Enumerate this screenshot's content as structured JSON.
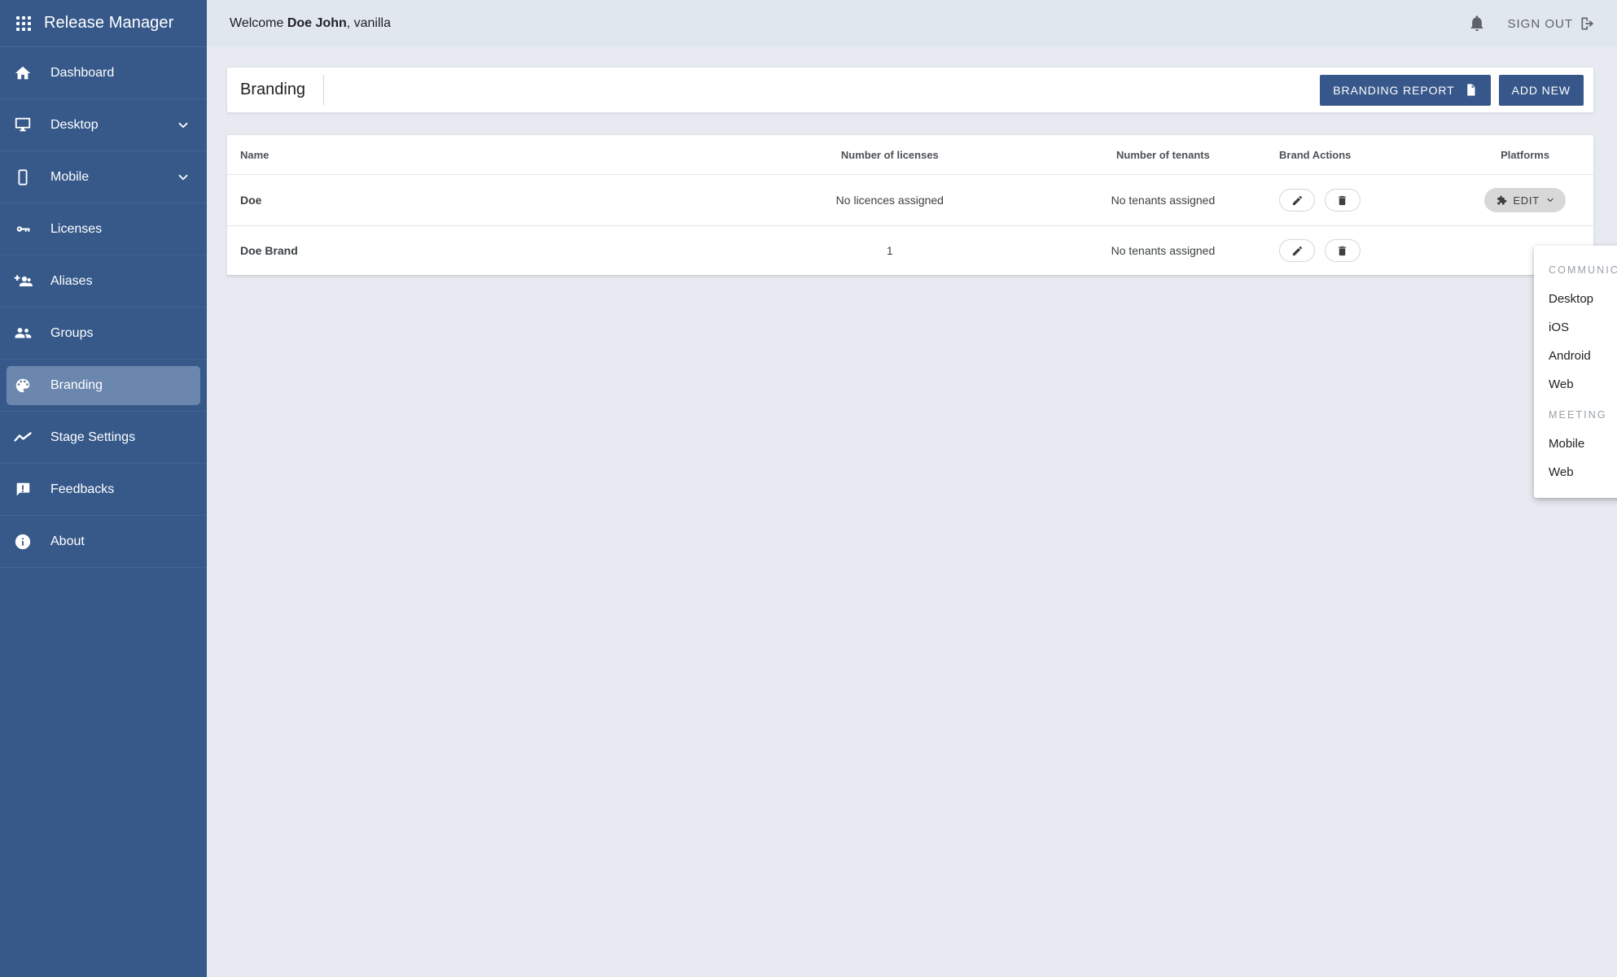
{
  "sidebar": {
    "brand": {
      "icon": "apps-grid-icon",
      "title": "Release Manager"
    },
    "items": [
      {
        "label": "Dashboard",
        "icon": "home-icon",
        "expandable": false,
        "active": false
      },
      {
        "label": "Desktop",
        "icon": "monitor-icon",
        "expandable": true,
        "active": false
      },
      {
        "label": "Mobile",
        "icon": "phone-icon",
        "expandable": true,
        "active": false
      },
      {
        "label": "Licenses",
        "icon": "key-icon",
        "expandable": false,
        "active": false
      },
      {
        "label": "Aliases",
        "icon": "person-add-icon",
        "expandable": false,
        "active": false
      },
      {
        "label": "Groups",
        "icon": "people-icon",
        "expandable": false,
        "active": false
      },
      {
        "label": "Branding",
        "icon": "palette-icon",
        "expandable": false,
        "active": true
      },
      {
        "label": "Stage Settings",
        "icon": "trending-icon",
        "expandable": false,
        "active": false
      },
      {
        "label": "Feedbacks",
        "icon": "feedback-icon",
        "expandable": false,
        "active": false
      },
      {
        "label": "About",
        "icon": "info-icon",
        "expandable": false,
        "active": false
      }
    ]
  },
  "topbar": {
    "welcome_prefix": "Welcome ",
    "user_name": "Doe John",
    "welcome_suffix": ", vanilla",
    "bell_icon": "notification-bell-icon",
    "signout_label": "SIGN OUT",
    "signout_icon": "logout-icon"
  },
  "page": {
    "title": "Branding",
    "buttons": {
      "report": {
        "label": "BRANDING REPORT",
        "icon": "document-icon"
      },
      "add_new": {
        "label": "ADD NEW"
      }
    }
  },
  "table": {
    "columns": [
      "Name",
      "Number of licenses",
      "Number of tenants",
      "Brand Actions",
      "Platforms"
    ],
    "rows": [
      {
        "name": "Doe",
        "licenses": "No licences assigned",
        "tenants": "No tenants assigned",
        "actions": [
          "edit-pencil-icon",
          "delete-trash-icon"
        ],
        "platform_button": {
          "label": "EDIT",
          "icon": "puzzle-piece-icon",
          "chevron": "chevron-down-icon"
        }
      },
      {
        "name": "Doe Brand",
        "licenses": "1",
        "tenants": "No tenants assigned",
        "actions": [
          "edit-pencil-icon",
          "delete-trash-icon"
        ],
        "platform_button": null
      }
    ]
  },
  "dropdown": {
    "open": true,
    "groups": [
      {
        "title": "COMMUNICATOR",
        "items": [
          "Desktop",
          "iOS",
          "Android",
          "Web"
        ]
      },
      {
        "title": "MEETING",
        "items": [
          "Mobile",
          "Web"
        ]
      }
    ]
  },
  "colors": {
    "sidebar_bg": "#36598a",
    "sidebar_active": "#6b87ad",
    "topbar_bg": "#e1e7ef",
    "content_bg": "#e7ebf1",
    "primary_button": "#37578a",
    "pill_button": "#d8d8d8"
  }
}
